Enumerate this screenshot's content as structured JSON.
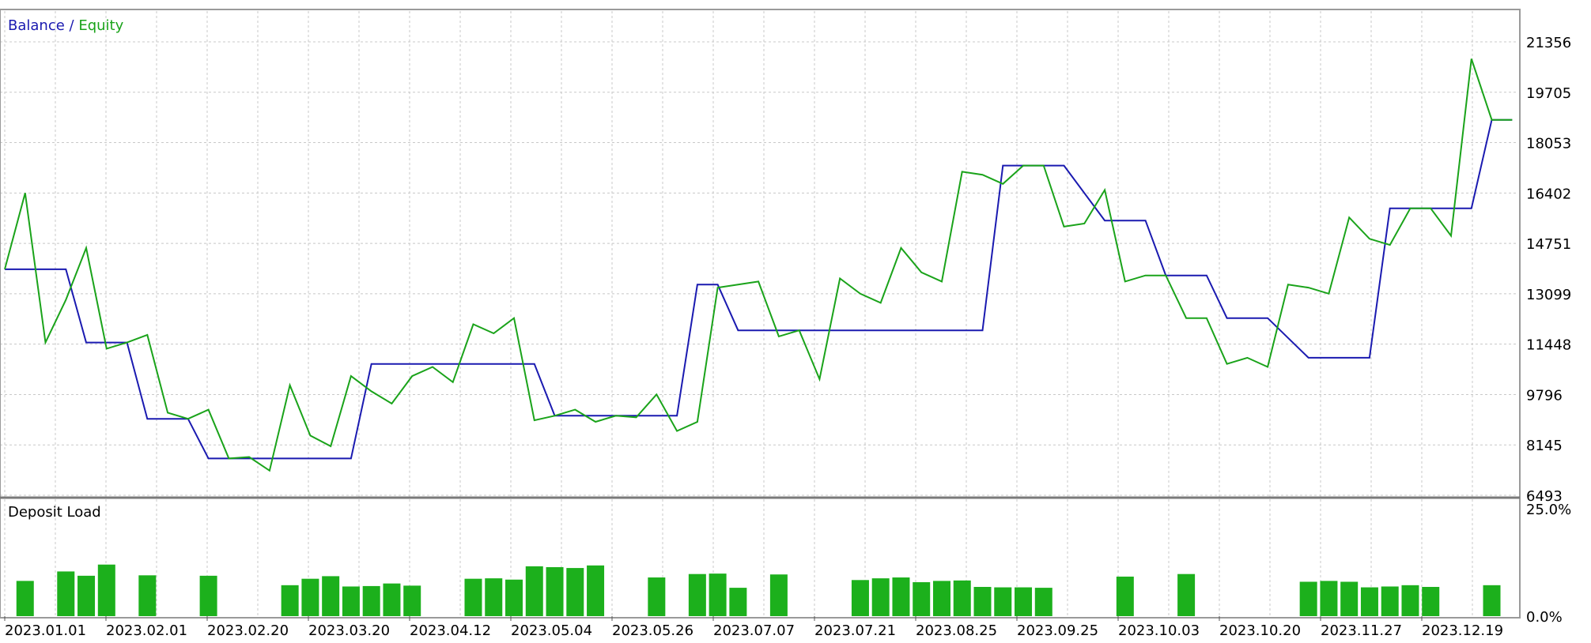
{
  "chart_data": [
    {
      "type": "line",
      "title": "",
      "legend": {
        "items": [
          "Balance",
          "Equity"
        ],
        "separator": "/",
        "placement": "top-left"
      },
      "y_ticks": [
        "21356",
        "19705",
        "18053",
        "16402",
        "14751",
        "13099",
        "11448",
        "9796",
        "8145",
        "6493"
      ],
      "ylim": [
        6493,
        21356
      ],
      "x_ticks": [
        "2023.01.01",
        "2023.02.01",
        "2023.02.20",
        "2023.03.20",
        "2023.04.12",
        "2023.05.04",
        "2023.05.26",
        "2023.07.07",
        "2023.07.21",
        "2023.08.25",
        "2023.09.25",
        "2023.10.03",
        "2023.10.20",
        "2023.11.27",
        "2023.12.19"
      ],
      "x_index_range": [
        0,
        74.3
      ],
      "series": [
        {
          "name": "Balance",
          "color": "#1a1ab0",
          "x": [
            0,
            3,
            4,
            6,
            7,
            9,
            10,
            12,
            17,
            18,
            26,
            27,
            33,
            34,
            35,
            36,
            48,
            49,
            52,
            54,
            56,
            57,
            59,
            60,
            62,
            64,
            66,
            67,
            68,
            69,
            70,
            71,
            72,
            73,
            74
          ],
          "y": [
            13900,
            13900,
            11500,
            11500,
            9000,
            9000,
            7700,
            7700,
            7700,
            10800,
            10800,
            9100,
            9100,
            13400,
            13400,
            11900,
            11900,
            17300,
            17300,
            15500,
            15500,
            13700,
            13700,
            12300,
            12300,
            11000,
            11000,
            11000,
            15900,
            15900,
            15900,
            15900,
            15900,
            18800,
            18800
          ],
          "breaks_note": ""
        },
        {
          "name": "Equity",
          "color": "#1aa31a",
          "x": [
            0,
            1,
            2,
            3,
            4,
            5,
            6,
            7,
            8,
            9,
            10,
            11,
            12,
            13,
            14,
            15,
            16,
            17,
            18,
            19,
            20,
            21,
            22,
            23,
            24,
            25,
            26,
            27,
            28,
            29,
            30,
            31,
            32,
            33,
            34,
            35,
            36,
            37,
            38,
            39,
            40,
            41,
            42,
            43,
            44,
            45,
            46,
            47,
            48,
            49,
            50,
            51,
            52,
            53,
            54,
            55,
            56,
            57,
            58,
            59,
            60,
            61,
            62,
            63,
            64,
            65,
            66,
            67,
            68,
            69,
            70,
            71,
            72,
            73,
            74
          ],
          "y": [
            13900,
            16400,
            11500,
            12900,
            14600,
            11300,
            11500,
            11750,
            9200,
            9000,
            9300,
            7700,
            7750,
            7300,
            10100,
            8450,
            8100,
            10400,
            9900,
            9500,
            10400,
            10700,
            10200,
            12100,
            11800,
            12300,
            8950,
            9100,
            9300,
            8900,
            9100,
            9050,
            9800,
            8600,
            8900,
            13300,
            13400,
            13500,
            11700,
            11900,
            10300,
            13600,
            13100,
            12800,
            14600,
            13800,
            13500,
            17100,
            17000,
            16700,
            17300,
            17300,
            15300,
            15400,
            16500,
            13500,
            13700,
            13700,
            12300,
            12300,
            10800,
            11000,
            10700,
            13400,
            13300,
            13100,
            15600,
            14900,
            14700,
            15900,
            15900,
            15000,
            20800,
            18800,
            18800
          ]
        }
      ]
    },
    {
      "type": "bar",
      "title": "Deposit Load",
      "y_ticks": [
        "25.0%",
        "0.0%"
      ],
      "ylim": [
        0,
        25
      ],
      "series": [
        {
          "name": "Deposit Load",
          "x": [
            1,
            3,
            4,
            5,
            7,
            10,
            14,
            15,
            16,
            17,
            18,
            19,
            20,
            23,
            24,
            25,
            26,
            27,
            28,
            29,
            32,
            34,
            35,
            36,
            38,
            42,
            43,
            44,
            45,
            46,
            47,
            48,
            49,
            50,
            51,
            55,
            58,
            64,
            65,
            66,
            67,
            68,
            69,
            70,
            73
          ],
          "values": [
            8.2,
            10.4,
            9.4,
            12.0,
            9.5,
            9.4,
            7.2,
            8.7,
            9.3,
            6.9,
            7.0,
            7.6,
            7.1,
            8.7,
            8.8,
            8.5,
            11.6,
            11.4,
            11.2,
            11.8,
            9.0,
            9.8,
            9.9,
            6.6,
            9.7,
            8.4,
            8.8,
            9.0,
            7.9,
            8.2,
            8.3,
            6.8,
            6.7,
            6.7,
            6.6,
            9.2,
            9.8,
            8.0,
            8.2,
            8.0,
            6.7,
            6.9,
            7.2,
            6.8,
            7.2
          ]
        }
      ]
    }
  ]
}
